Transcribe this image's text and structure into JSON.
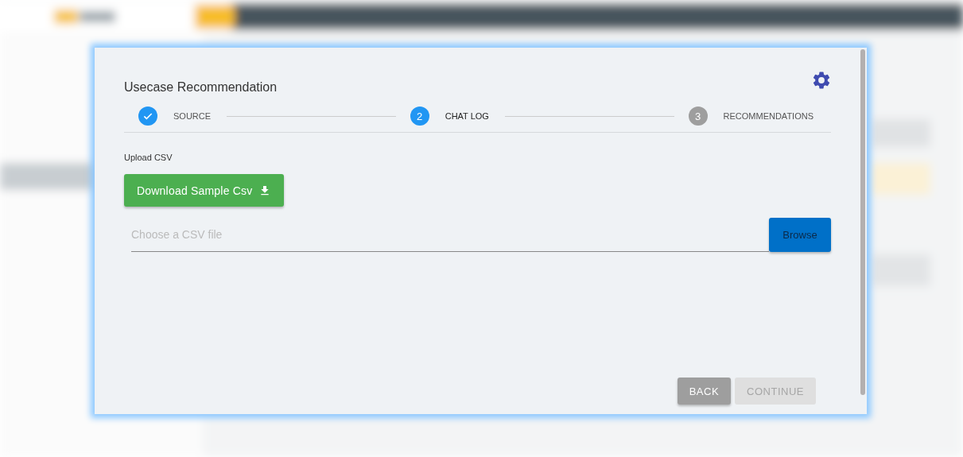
{
  "dialog": {
    "title": "Usecase Recommendation"
  },
  "steps": [
    {
      "label": "SOURCE",
      "done": true,
      "selected": false
    },
    {
      "label": "CHAT LOG",
      "number": "2",
      "done": false,
      "selected": true
    },
    {
      "label": "RECOMMENDATIONS",
      "number": "3",
      "done": false,
      "selected": false
    }
  ],
  "upload": {
    "label": "Upload CSV",
    "download_button": "Download Sample Csv",
    "file_field": {
      "placeholder": "Choose a CSV file"
    },
    "browse_button": "Browse"
  },
  "actions": [
    {
      "label": "BACK",
      "disabled": false
    },
    {
      "label": "CONTINUE",
      "disabled": true
    }
  ]
}
